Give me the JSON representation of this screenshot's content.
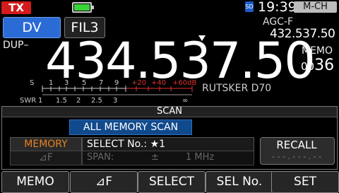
{
  "status": {
    "tx_label": "TX",
    "sd_label": "SD",
    "time": "19:39",
    "channel_mode": "M-CH",
    "battery_level": 1.0
  },
  "mode": {
    "mode_label": "DV",
    "filter_label": "FIL3",
    "agc_label": "AGC-F",
    "sub_frequency": "432.537.50",
    "duplex_label": "DUP–",
    "frequency": "434.537.50",
    "memo_label": "MEMO",
    "memo_prefix": "00",
    "memo_number": "36"
  },
  "meter": {
    "s_label": "S",
    "s_ticks": [
      "1",
      "3",
      "5",
      "7",
      "9"
    ],
    "s_plus_ticks": [
      "+20",
      "+40",
      "+60dB"
    ],
    "swr_label": "SWR",
    "swr_ticks": [
      "1",
      "1.5",
      "2",
      "2.5",
      "3",
      "∞"
    ],
    "radio_label": "RUTSKER D70"
  },
  "scan": {
    "header": "SCAN",
    "type": "ALL MEMORY SCAN",
    "memory_btn": "MEMORY",
    "delta_f_btn": "⊿F",
    "select_no": "SELECT No.: ★1",
    "span_label": "SPAN:",
    "span_pm": "±",
    "span_value": "1 MHz",
    "recall_label": "RECALL",
    "recall_value": "- - - . - - - . - -"
  },
  "softkeys": [
    "MEMO",
    "⊿F",
    "SELECT",
    "SEL No.",
    "SET"
  ],
  "colors": {
    "tx": "#d41a1a",
    "mode_blue": "#2b6bd6",
    "scan_blue": "#114a8c",
    "memory_orange": "#e8821e",
    "meter_red": "#e23030"
  }
}
